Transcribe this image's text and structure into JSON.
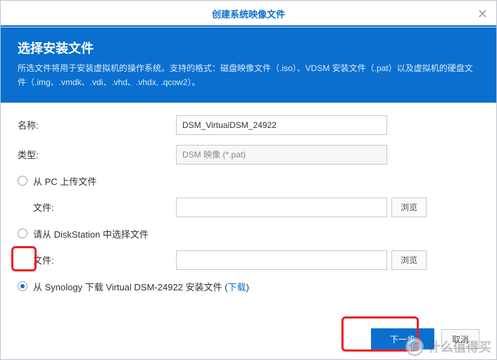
{
  "titlebar": {
    "title": "创建系统映像文件",
    "close": "✕"
  },
  "header": {
    "title": "选择安装文件",
    "desc": "所选文件将用于安装虚拟机的操作系统。支持的格式：磁盘映像文件（.iso）、VDSM 安装文件（.pat）以及虚拟机的硬盘文件（.img、.vmdk、.vdi、.vhd、.vhdx, .qcow2）。"
  },
  "form": {
    "name_label": "名称:",
    "name_value": "DSM_VirtualDSM_24922",
    "type_label": "类型:",
    "type_value": "DSM 映像 (*.pat)",
    "opt_pc": "从 PC 上传文件",
    "file_label": "文件:",
    "browse": "浏览",
    "opt_ds": "请从 DiskStation 中选择文件",
    "opt_dl_prefix": "从 Synology 下载 Virtual DSM-24922 安装文件 (",
    "opt_dl_link": "下载",
    "opt_dl_suffix": ")"
  },
  "footer": {
    "next": "下一步",
    "cancel": "取消"
  },
  "watermark": {
    "badge": "值",
    "text": "什么值得买"
  }
}
